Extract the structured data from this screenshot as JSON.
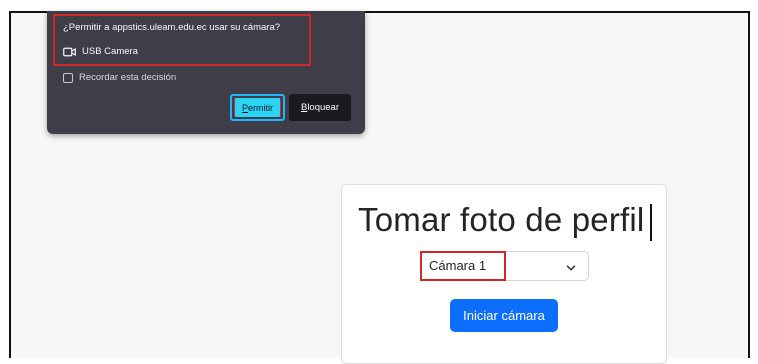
{
  "permission_prompt": {
    "question": "¿Permitir a appstics.uleam.edu.ec usar su cámara?",
    "device_icon": "camera-icon",
    "device": "USB Camera",
    "remember_label": "Recordar esta decisión",
    "remember_checked": false,
    "allow_label": "Permitir",
    "block_label": "Bloquear"
  },
  "card": {
    "title": "Tomar foto de perfil",
    "camera_select": {
      "selected": "Cámara 1",
      "chevron_icon": "chevron-down-icon"
    },
    "start_button_label": "Iniciar cámara"
  },
  "colors": {
    "popup_bg": "#3f3d48",
    "allow_button": "#2ad4f5",
    "block_button": "#1b1a20",
    "primary_button": "#0d6efd",
    "highlight_red": "#d02828"
  }
}
